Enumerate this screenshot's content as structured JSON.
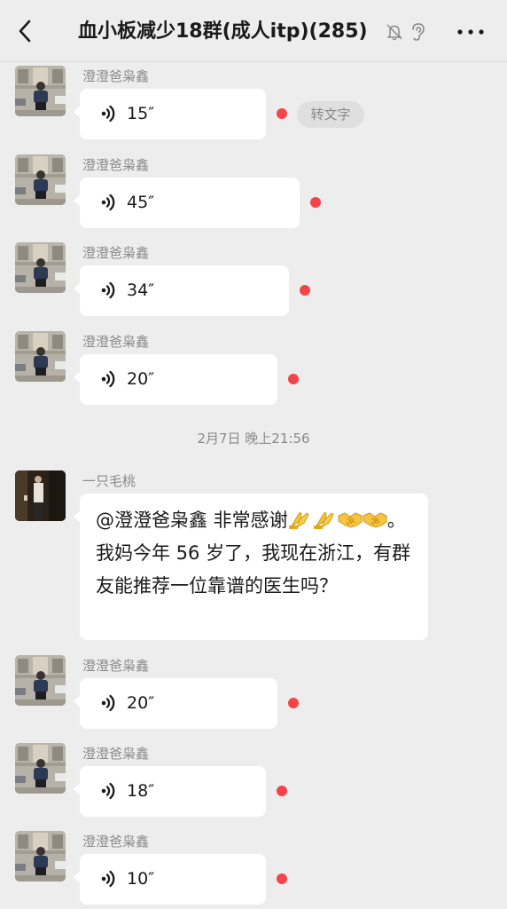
{
  "header": {
    "title": "血小板减少18群(成人itp)(285)"
  },
  "messages": [
    {
      "sender": "澄澄爸枭鑫",
      "duration": "15″"
    },
    {
      "sender": "澄澄爸枭鑫",
      "duration": "45″"
    },
    {
      "sender": "澄澄爸枭鑫",
      "duration": "34″"
    },
    {
      "sender": "澄澄爸枭鑫",
      "duration": "20″"
    },
    {
      "sender": "一只毛桃",
      "text_a": "@澄澄爸枭鑫  非常感谢",
      "text_b": "。我妈今年 56 岁了，我现在浙江，有群友能推荐一位靠谱的医生吗？"
    },
    {
      "sender": "澄澄爸枭鑫",
      "duration": "20″"
    },
    {
      "sender": "澄澄爸枭鑫",
      "duration": "18″"
    },
    {
      "sender": "澄澄爸枭鑫",
      "duration": "10″"
    }
  ],
  "to_text_label": "转文字",
  "timestamp": "2月7日 晚上21:56",
  "colors": {
    "background": "#ededed",
    "bubble": "#ffffff",
    "unread_dot": "#f4444a",
    "meta_text": "#8a8a8a"
  }
}
